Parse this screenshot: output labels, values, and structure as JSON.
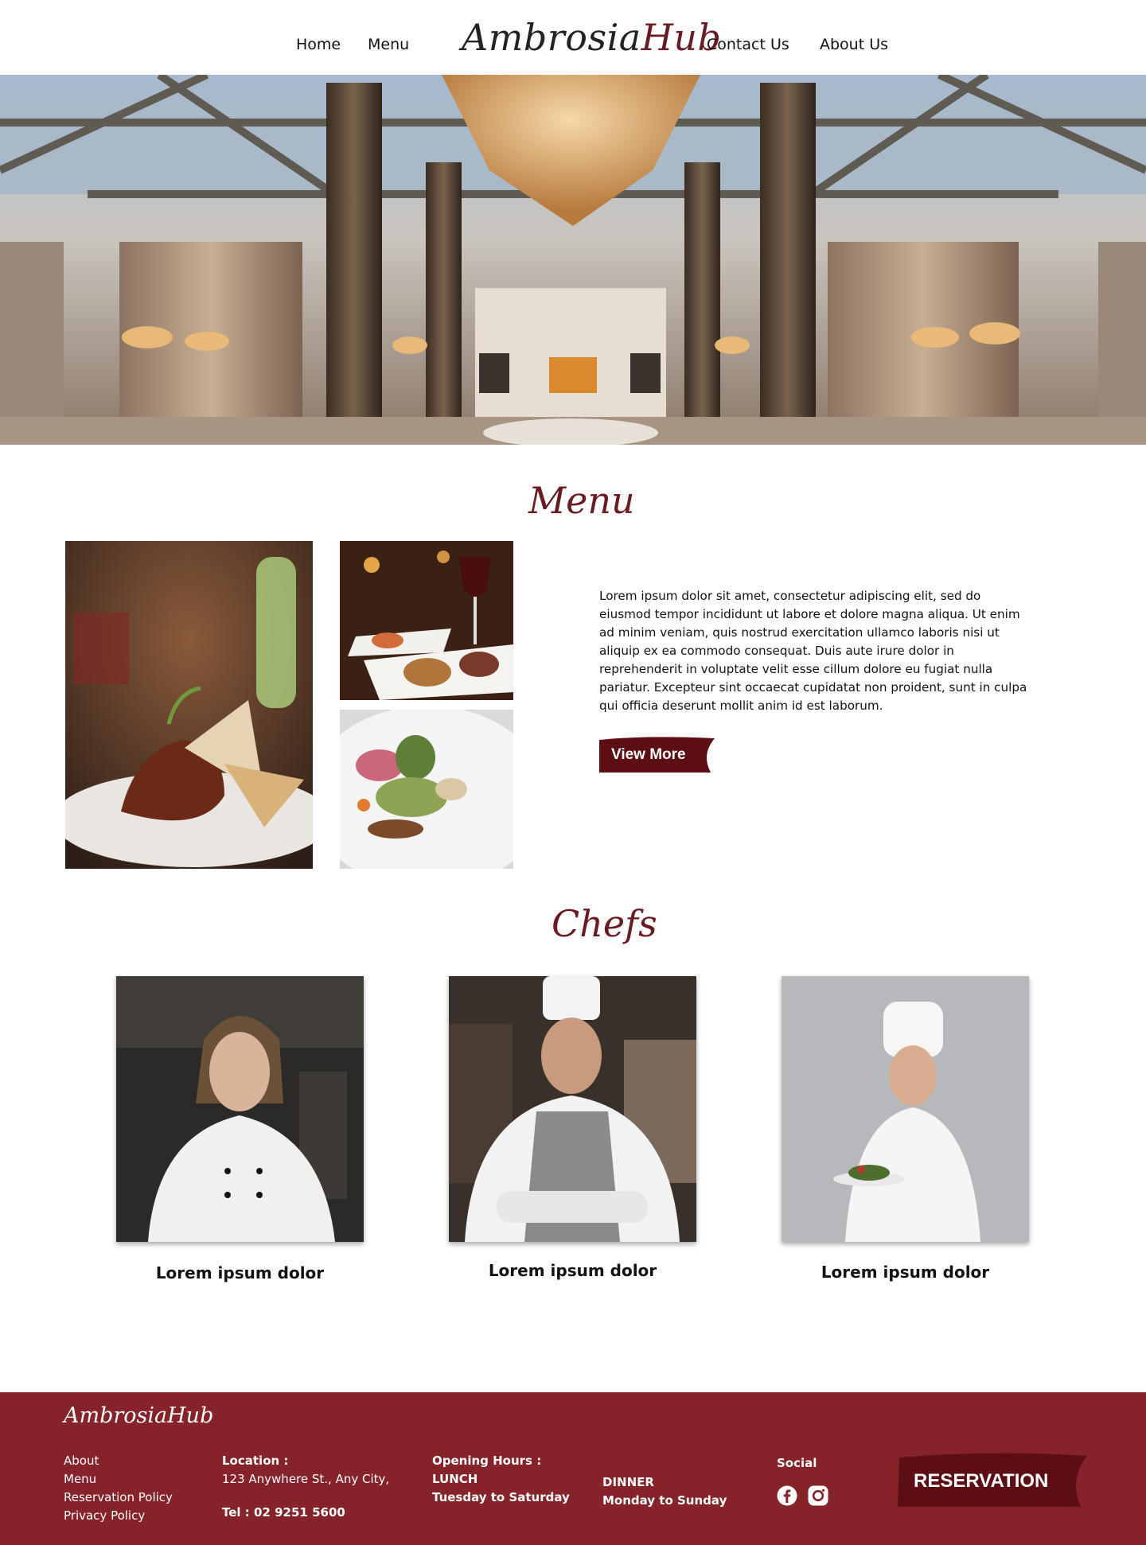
{
  "nav": {
    "home": "Home",
    "menu": "Menu",
    "brand_main": "Ambrosia",
    "brand_accent": "Hub",
    "contact": "Contact Us",
    "about": "About Us"
  },
  "menu_section": {
    "title": "Menu",
    "description": "Lorem ipsum dolor sit amet, consectetur adipiscing elit, sed do eiusmod tempor incididunt ut labore et dolore magna aliqua. Ut enim ad minim veniam, quis nostrud exercitation ullamco laboris nisi ut aliquip ex ea commodo consequat. Duis aute irure dolor in reprehenderit in voluptate velit esse cillum dolore eu fugiat nulla pariatur. Excepteur sint occaecat cupidatat non proident, sunt in culpa qui officia deserunt mollit anim id est laborum.",
    "button": "View More"
  },
  "chefs_section": {
    "title": "Chefs",
    "chefs": [
      {
        "name": "Lorem ipsum dolor"
      },
      {
        "name": "Lorem ipsum dolor"
      },
      {
        "name": "Lorem ipsum dolor"
      }
    ]
  },
  "footer": {
    "brand": "AmbrosiaHub",
    "links": [
      "About",
      "Menu",
      "Reservation Policy",
      "Privacy Policy"
    ],
    "location_label": "Location :",
    "address": "123 Anywhere St., Any City,",
    "tel": "Tel : 02 9251 5600",
    "hours_label": "Opening Hours :",
    "lunch_label": "LUNCH",
    "lunch_days": "Tuesday to Saturday",
    "dinner_label": "DINNER",
    "dinner_days": "Monday to Sunday",
    "social_label": "Social",
    "social_icons": [
      "facebook-icon",
      "instagram-icon"
    ],
    "reservation_button": "RESERVATION"
  },
  "colors": {
    "brand_maroon": "#6a1a22",
    "footer_bg": "#86232a",
    "button_dark": "#5c0e14"
  }
}
